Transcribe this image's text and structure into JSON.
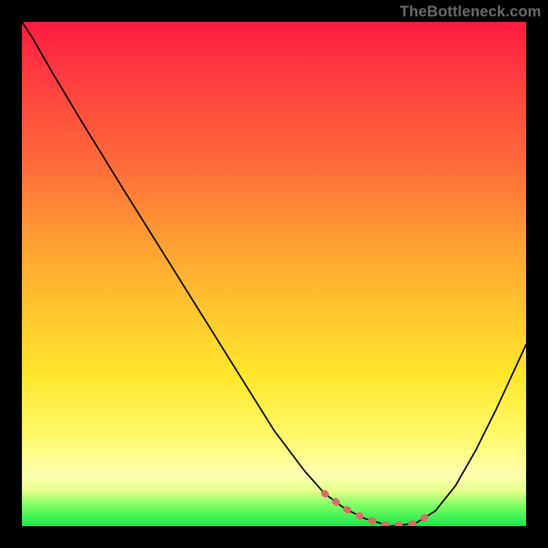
{
  "watermark": "TheBottleneck.com",
  "colors": {
    "frame": "#000000",
    "watermark_text": "#6a6a6a",
    "curve": "#000000",
    "highlight": "#db6b66",
    "gradient_stops": [
      {
        "pos": 0.0,
        "hex": "#ff1a3f"
      },
      {
        "pos": 0.1,
        "hex": "#ff3a3f"
      },
      {
        "pos": 0.28,
        "hex": "#ff6a3a"
      },
      {
        "pos": 0.42,
        "hex": "#ff9a33"
      },
      {
        "pos": 0.56,
        "hex": "#ffc22e"
      },
      {
        "pos": 0.7,
        "hex": "#ffe62a"
      },
      {
        "pos": 0.82,
        "hex": "#fff96a"
      },
      {
        "pos": 0.9,
        "hex": "#fdffb0"
      },
      {
        "pos": 0.93,
        "hex": "#e6ff8a"
      },
      {
        "pos": 0.96,
        "hex": "#7cff63"
      },
      {
        "pos": 1.0,
        "hex": "#17e84a"
      }
    ]
  },
  "chart_data": {
    "type": "line",
    "title": "",
    "xlabel": "",
    "ylabel": "",
    "xlim": [
      0,
      1
    ],
    "ylim": [
      0,
      1
    ],
    "grid": false,
    "legend": false,
    "description": "A single black V-shaped curve over a vertical red→yellow→green gradient. The minimum of the curve (near y≈0) is emphasized by a short red/coral dashed segment hugging the bottom of the valley. Curve values are estimated from pixels (no axis ticks present); x and y are in normalized 0–1 plot coordinates with y=0 at the bottom.",
    "series": [
      {
        "name": "curve",
        "x": [
          0.0,
          0.02,
          0.06,
          0.12,
          0.2,
          0.3,
          0.4,
          0.5,
          0.56,
          0.6,
          0.64,
          0.68,
          0.73,
          0.78,
          0.82,
          0.86,
          0.9,
          0.94,
          1.0
        ],
        "y": [
          1.0,
          0.97,
          0.9,
          0.8,
          0.67,
          0.51,
          0.35,
          0.19,
          0.11,
          0.065,
          0.035,
          0.015,
          0.0,
          0.005,
          0.03,
          0.08,
          0.15,
          0.23,
          0.36
        ]
      }
    ],
    "highlight_segment": {
      "name": "valley-emphasis",
      "x": [
        0.6,
        0.64,
        0.68,
        0.73,
        0.78,
        0.82
      ],
      "y": [
        0.065,
        0.035,
        0.015,
        0.0,
        0.005,
        0.03
      ]
    }
  }
}
